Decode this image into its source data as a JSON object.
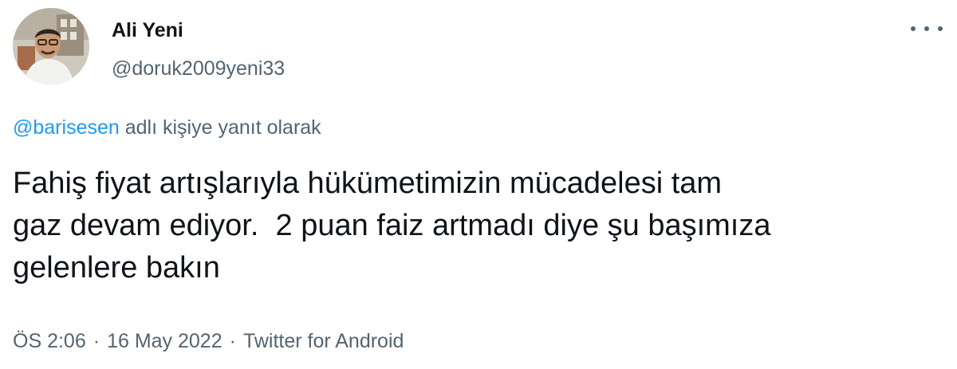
{
  "user": {
    "name": "Ali Yeni",
    "handle": "@doruk2009yeni33"
  },
  "more_icon": "more-horizontal-icon",
  "reply": {
    "mention": "@barisesen",
    "suffix": " adlı kişiye yanıt olarak"
  },
  "tweet": {
    "lines": [
      "Fahiş fiyat artışlarıyla hükümetimizin mücadelesi tam",
      "gaz devam ediyor.  2 puan faiz artmadı diye şu başımıza",
      "gelenlere bakın"
    ]
  },
  "meta": {
    "time": "ÖS 2:06",
    "separator": "·",
    "date": "16 May 2022",
    "source": "Twitter for Android"
  },
  "colors": {
    "text": "#0f1419",
    "secondary": "#536471",
    "link": "#1d9bf0"
  }
}
